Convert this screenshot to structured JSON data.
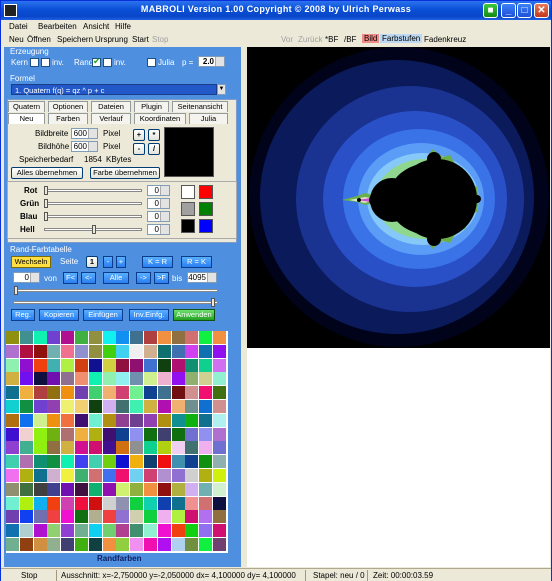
{
  "window": {
    "title": "MABROLI   Version 1.00   Copyright © 2008 by Ulrich Perwass"
  },
  "menu": [
    "Datei",
    "Bearbeiten",
    "Ansicht",
    "Hilfe"
  ],
  "toolbar": {
    "neu": "Neu",
    "offnen": "Öffnen",
    "speichern": "Speichern",
    "ursprung": "Ursprung",
    "start": "Start",
    "stop": "Stop",
    "vor": "Vor",
    "zuruck": "Zurück",
    "bf_star": "*BF",
    "bf": "/BF",
    "bild": "Bild",
    "farbstufen": "Farbstufen",
    "fadenkreuz": "Fadenkreuz"
  },
  "erzeugung": {
    "label": "Erzeugung",
    "kern": "Kern",
    "inv1": "inv.",
    "rand": "Rand",
    "inv2": "inv.",
    "julia": "Julia",
    "p_label": "p =",
    "p_value": "2.0"
  },
  "formel": {
    "label": "Formel",
    "value": "1. Quatern     f(q) = qz ^ p + c"
  },
  "tabs_row1": [
    "Quatern",
    "Optionen",
    "Dateien",
    "Plugin",
    "Seitenansicht"
  ],
  "tabs_row2": [
    "Neu",
    "Farben",
    "Verlauf",
    "Koordinaten",
    "Julia"
  ],
  "neu": {
    "bildbreite": "Bildbreite",
    "bildbreite_val": "600",
    "bildhoehe": "Bildhöhe",
    "bildhoehe_val": "600",
    "pixel1": "Pixel",
    "pixel2": "Pixel",
    "speicher": "Speicherbedarf",
    "speicher_val": "1854",
    "kbytes": "KBytes",
    "alles": "Alles übernehmen",
    "farbe": "Farbe übernehmen",
    "plus": "+",
    "star": "*",
    "minus": "-",
    "slash": "/"
  },
  "colors": {
    "rot": "Rot",
    "gruen": "Grün",
    "blau": "Blau",
    "hell": "Hell",
    "rot_val": "0",
    "gruen_val": "0",
    "blau_val": "0",
    "hell_val": "0"
  },
  "rand": {
    "label": "Rand-Farbtabelle",
    "wechseln": "Wechseln",
    "seite": "Seite",
    "seite_val": "1",
    "minus": "-",
    "plus": "+",
    "kr": "K = R",
    "rk": "R = K",
    "von_val": "0",
    "von": "von",
    "f_back": "F<",
    "back": "<-",
    "alle": "Alle",
    "fwd": "->",
    "f_fwd": ">F",
    "bis_val": "4095",
    "bis": "bis",
    "reg": "Reg.",
    "kopieren": "Kopieren",
    "einfugen": "Einfügen",
    "inveinfg": "Inv.Einfg.",
    "anwenden": "Anwenden",
    "randfarben": "Randfarben"
  },
  "status": {
    "state": "Stop",
    "ausschnitt": "Ausschnitt: x=-2,750000  y=-2,050000  dx= 4,100000  dy= 4,100000",
    "stapel": "Stapel: neu / 0",
    "zeit": "Zeit:  00:00:03.59"
  },
  "accent": {
    "panel": "#4f8fe0",
    "titlebar": "#0a4fd6"
  }
}
